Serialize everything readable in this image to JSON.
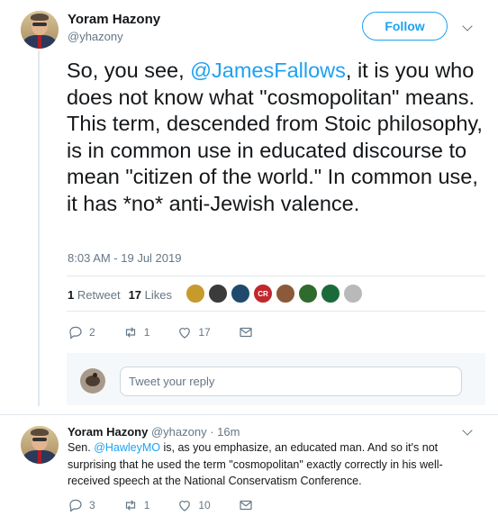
{
  "main_tweet": {
    "author_name": "Yoram Hazony",
    "author_handle": "@yhazony",
    "follow_label": "Follow",
    "text_before": "So, you see, ",
    "mention": "@JamesFallows",
    "text_after": ", it is you who does not know what \"cosmopolitan\" means. This term, descended from Stoic philosophy, is in common use in educated discourse to mean \"citizen of the world.\" In common use, it has  *no* anti-Jewish valence.",
    "timestamp": "8:03 AM - 19 Jul 2019",
    "retweets_count": "1",
    "retweets_label": "Retweet",
    "likes_count": "17",
    "likes_label": "Likes",
    "actions": {
      "replies": "2",
      "retweets": "1",
      "likes": "17"
    }
  },
  "likers": [
    {
      "color": "#c79a2c"
    },
    {
      "color": "#3b3b3b"
    },
    {
      "color": "#1f4a6b"
    },
    {
      "color": "#c0282d",
      "label": "CR"
    },
    {
      "color": "#8a5a3a"
    },
    {
      "color": "#2f6b2c"
    },
    {
      "color": "#1b6b3a"
    },
    {
      "color": "#b9b9b9"
    }
  ],
  "reply_box": {
    "placeholder": "Tweet your reply"
  },
  "reply_tweet": {
    "author_name": "Yoram Hazony",
    "author_handle": "@yhazony",
    "time": "· 16m",
    "text_before": "Sen. ",
    "mention": "@HawleyMO",
    "text_after": " is, as you emphasize, an educated man. And so it's not surprising that he used the term \"cosmopolitan\" exactly correctly in his well-received speech at the National Conservatism Conference.",
    "actions": {
      "replies": "3",
      "retweets": "1",
      "likes": "10"
    }
  },
  "colors": {
    "accent": "#1da1f2",
    "muted": "#657786",
    "text": "#14171a"
  },
  "icons": [
    "chevron-down-icon",
    "reply-icon",
    "retweet-icon",
    "heart-icon",
    "message-icon"
  ]
}
